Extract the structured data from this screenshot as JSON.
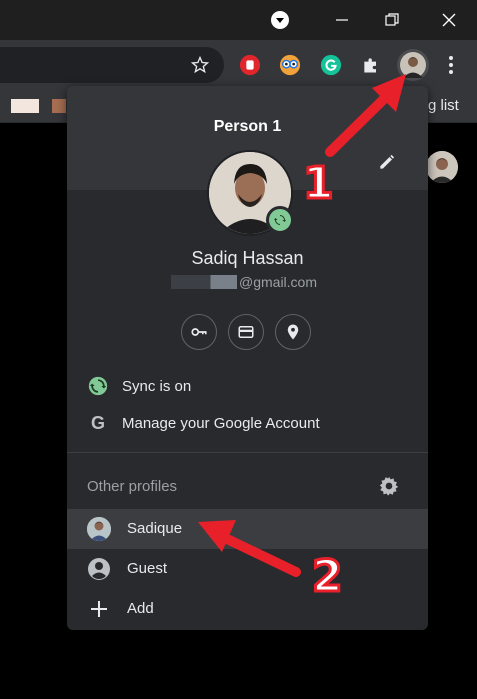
{
  "browser": {
    "bookmarks_trailing_text": "g list",
    "icons": {
      "star": "star-icon",
      "extensions": [
        "adblock-hand-icon",
        "owl-extension-icon",
        "grammarly-icon",
        "puzzle-extensions-icon"
      ],
      "menu": "more-vert-icon"
    }
  },
  "menu": {
    "person_title": "Person 1",
    "user_name": "Sadiq Hassan",
    "email_suffix": "@gmail.com",
    "quick_actions": [
      "key-icon",
      "card-icon",
      "location-icon"
    ],
    "sync_label": "Sync is on",
    "manage_label": "Manage your Google Account",
    "other_profiles_label": "Other profiles",
    "profiles": [
      {
        "label": "Sadique",
        "icon": "profile-avatar"
      },
      {
        "label": "Guest",
        "icon": "guest-icon"
      },
      {
        "label": "Add",
        "icon": "plus-icon"
      }
    ]
  },
  "annotations": {
    "one": "1",
    "two": "2"
  },
  "colors": {
    "menu_bg": "#292a2d",
    "header_bg": "#35363a",
    "sync_green": "#81c995",
    "arrow_red": "#e8202a"
  }
}
